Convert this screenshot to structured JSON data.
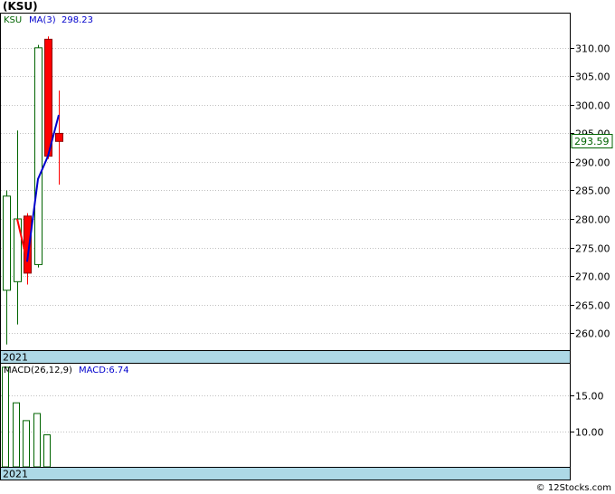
{
  "title": "(KSU)",
  "footer": "© 12Stocks.com",
  "colors": {
    "up": "#006400",
    "down": "#ff0000",
    "ma": "#0000cc",
    "year_band": "#add8e6",
    "grid": "#c0c0c0"
  },
  "chart_data": [
    {
      "type": "candlestick",
      "legend": {
        "ticker": "KSU",
        "ma_label": "MA(3)",
        "ma_value": "298.23"
      },
      "last_price": "293.59",
      "year_label": "2021",
      "ylim": [
        257,
        316
      ],
      "yticks": [
        "310.00",
        "305.00",
        "300.00",
        "295.00",
        "290.00",
        "285.00",
        "280.00",
        "275.00",
        "270.00",
        "265.00",
        "260.00"
      ],
      "candles": [
        {
          "open": 267.5,
          "high": 285.0,
          "low": 258.0,
          "close": 284.0
        },
        {
          "open": 269.0,
          "high": 295.5,
          "low": 261.5,
          "close": 280.0
        },
        {
          "open": 280.5,
          "high": 281.0,
          "low": 268.5,
          "close": 270.5
        },
        {
          "open": 272.0,
          "high": 310.5,
          "low": 271.5,
          "close": 310.0
        },
        {
          "open": 311.5,
          "high": 312.0,
          "low": 290.5,
          "close": 291.0
        },
        {
          "open": 295.0,
          "high": 302.5,
          "low": 286.0,
          "close": 293.59
        }
      ],
      "ma": [
        null,
        280.0,
        272.5,
        287.0,
        291.0,
        298.23
      ]
    },
    {
      "type": "bar",
      "title": "MACD(26,12,9)",
      "value_label": "MACD:6.74",
      "year_label": "2021",
      "ylim": [
        5.0,
        19.5
      ],
      "yticks": [
        "15.00",
        "10.00"
      ],
      "values": [
        19.0,
        14.0,
        11.5,
        12.5,
        9.5
      ]
    }
  ]
}
